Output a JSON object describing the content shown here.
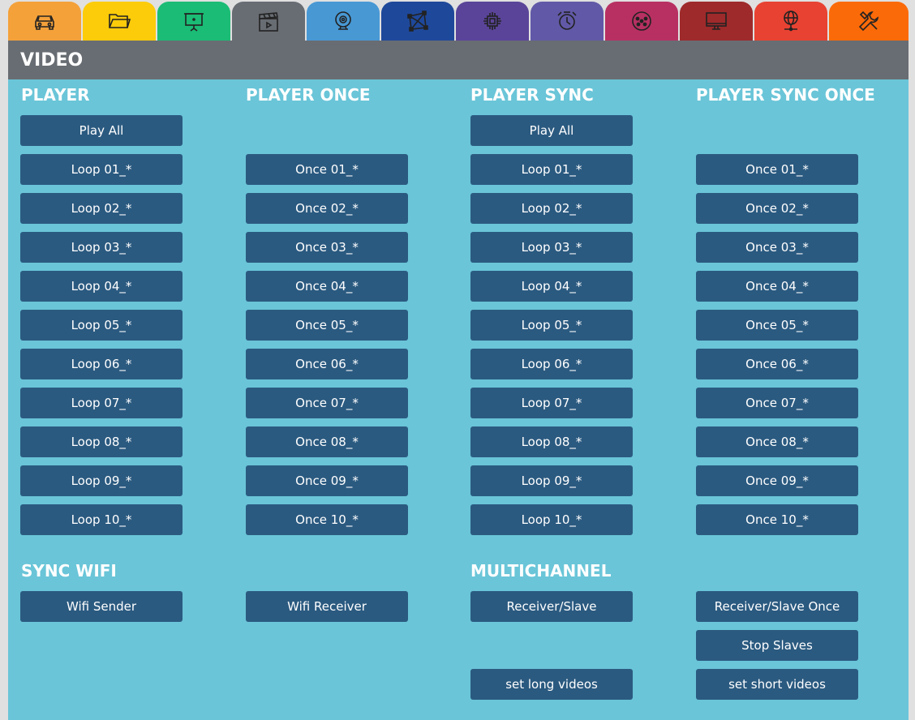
{
  "tabs": [
    {
      "icon": "car-icon",
      "color": "#f4a13a"
    },
    {
      "icon": "folder-icon",
      "color": "#fccc0a"
    },
    {
      "icon": "projector-screen-icon",
      "color": "#1bbc75"
    },
    {
      "icon": "clapperboard-icon",
      "color": "#686d73",
      "active": true
    },
    {
      "icon": "webcam-icon",
      "color": "#4898d4"
    },
    {
      "icon": "projection-map-icon",
      "color": "#1e489a"
    },
    {
      "icon": "chip-icon",
      "color": "#5a4499"
    },
    {
      "icon": "alarm-clock-icon",
      "color": "#6159a7"
    },
    {
      "icon": "dmx-connector-icon",
      "color": "#b83062"
    },
    {
      "icon": "monitor-icon",
      "color": "#9e2a2b"
    },
    {
      "icon": "network-globe-icon",
      "color": "#e84232"
    },
    {
      "icon": "tools-icon",
      "color": "#fb6a09"
    }
  ],
  "section_title": "VIDEO",
  "columns": {
    "player": {
      "title": "PLAYER",
      "play_all": "Play All",
      "items": [
        "Loop 01_*",
        "Loop 02_*",
        "Loop 03_*",
        "Loop 04_*",
        "Loop 05_*",
        "Loop 06_*",
        "Loop 07_*",
        "Loop 08_*",
        "Loop 09_*",
        "Loop 10_*"
      ]
    },
    "player_once": {
      "title": "PLAYER ONCE",
      "items": [
        "Once 01_*",
        "Once 02_*",
        "Once 03_*",
        "Once 04_*",
        "Once 05_*",
        "Once 06_*",
        "Once 07_*",
        "Once 08_*",
        "Once 09_*",
        "Once 10_*"
      ]
    },
    "player_sync": {
      "title": "PLAYER SYNC",
      "play_all": "Play All",
      "items": [
        "Loop 01_*",
        "Loop 02_*",
        "Loop 03_*",
        "Loop 04_*",
        "Loop 05_*",
        "Loop 06_*",
        "Loop 07_*",
        "Loop 08_*",
        "Loop 09_*",
        "Loop 10_*"
      ]
    },
    "player_sync_once": {
      "title": "PLAYER SYNC ONCE",
      "items": [
        "Once 01_*",
        "Once 02_*",
        "Once 03_*",
        "Once 04_*",
        "Once 05_*",
        "Once 06_*",
        "Once 07_*",
        "Once 08_*",
        "Once 09_*",
        "Once 10_*"
      ]
    }
  },
  "sync_wifi": {
    "title": "SYNC WIFI",
    "sender": "Wifi Sender",
    "receiver": "Wifi Receiver"
  },
  "multichannel": {
    "title": "MULTICHANNEL",
    "receiver_slave": "Receiver/Slave",
    "receiver_slave_once": "Receiver/Slave Once",
    "stop_slaves": "Stop Slaves",
    "set_long": "set long videos",
    "set_short": "set short videos"
  },
  "colors": {
    "panel_bg": "#6ac5d8",
    "header_bg": "#686d73",
    "button_bg": "#2b5a80",
    "text": "#ffffff"
  }
}
